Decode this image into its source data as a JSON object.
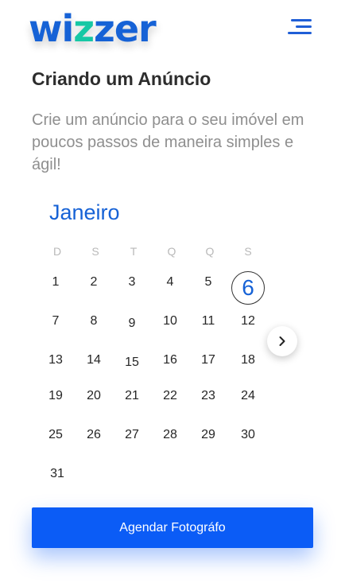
{
  "header": {
    "logo_part1": "wi",
    "logo_part2": "z",
    "logo_part3": "zer",
    "menu_icon": "hamburger-menu-icon",
    "brand_color": "#1662d6",
    "accent_color": "#17c8a5"
  },
  "page": {
    "title": "Criando um Anúncio",
    "description": "Crie um anúncio para o seu imóvel em poucos passos de maneira simples e ágil!"
  },
  "calendar": {
    "month": "Janeiro",
    "weekdays": [
      "D",
      "S",
      "T",
      "Q",
      "Q",
      "S"
    ],
    "weeks": [
      [
        "1",
        "2",
        "3",
        "4",
        "5",
        "6"
      ],
      [
        "7",
        "8",
        "9",
        "10",
        "11",
        "12"
      ],
      [
        "13",
        "14",
        "15",
        "16",
        "17",
        "18"
      ],
      [
        "19",
        "20",
        "21",
        "22",
        "23",
        "24"
      ],
      [
        "25",
        "26",
        "27",
        "28",
        "29",
        "30"
      ],
      [
        "31"
      ]
    ],
    "selected_day": "6",
    "next_icon": "chevron-right-icon"
  },
  "actions": {
    "schedule_label": "Agendar Fotográfo",
    "button_color": "#0b5cf6"
  }
}
